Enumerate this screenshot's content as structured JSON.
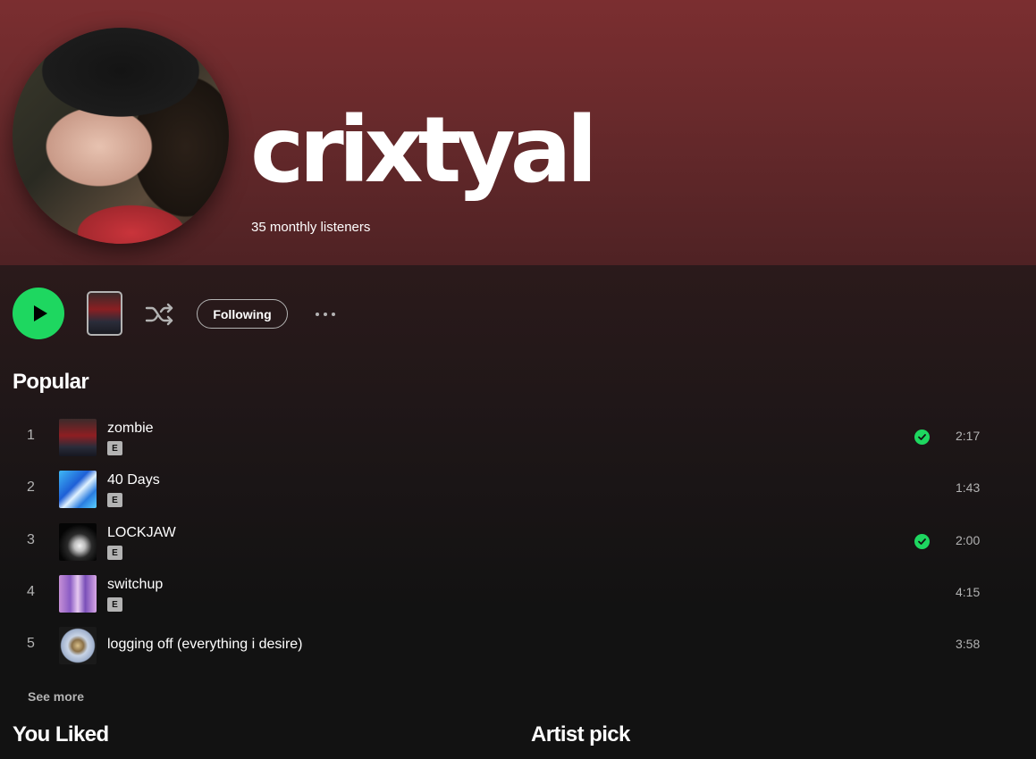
{
  "artist": {
    "name": "crixtyal",
    "monthly_listeners": "35 monthly listeners"
  },
  "actions": {
    "follow_label": "Following"
  },
  "popular": {
    "title": "Popular",
    "tracks": [
      {
        "rank": "1",
        "title": "zombie",
        "explicit": "E",
        "liked": true,
        "duration": "2:17"
      },
      {
        "rank": "2",
        "title": "40 Days",
        "explicit": "E",
        "liked": false,
        "duration": "1:43"
      },
      {
        "rank": "3",
        "title": "LOCKJAW",
        "explicit": "E",
        "liked": true,
        "duration": "2:00"
      },
      {
        "rank": "4",
        "title": "switchup",
        "explicit": "E",
        "liked": false,
        "duration": "4:15"
      },
      {
        "rank": "5",
        "title": "logging off (everything i desire)",
        "explicit": null,
        "liked": false,
        "duration": "3:58"
      }
    ],
    "see_more_label": "See more"
  },
  "sections": {
    "you_liked": "You Liked",
    "artist_pick": "Artist pick"
  },
  "colors": {
    "accent": "#1ed760",
    "hero_top": "#7b2e30",
    "background": "#121212",
    "text_muted": "#b3b3b3"
  },
  "icons": {
    "play": "play-icon",
    "shuffle": "shuffle-icon",
    "more": "more-options-icon",
    "liked": "check-circle-icon",
    "explicit": "explicit-badge"
  }
}
